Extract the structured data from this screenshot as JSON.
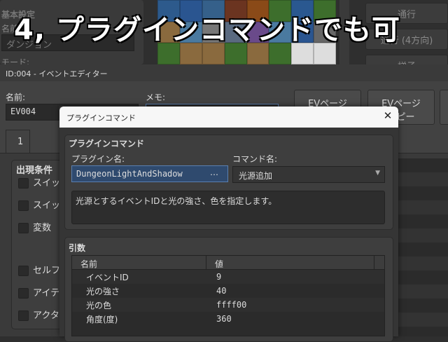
{
  "background": {
    "basic_settings": "基本設定",
    "name_label": "名前:",
    "name_value": "ダンジョン",
    "mode_label": "モード:",
    "buttons": [
      "通行",
      "通行 (4方向)",
      "梯子"
    ]
  },
  "overlay_caption": "4, プラグインコマンドでも可",
  "event_editor": {
    "title": "ID:004 - イベントエディター",
    "name_label": "名前:",
    "name_value": "EV004",
    "memo_label": "メモ:",
    "memo_value": "",
    "page_buttons": [
      "EVページ\n新規作成",
      "EVページ\nコピー"
    ],
    "tab": "1",
    "conditions_label": "出現条件",
    "conditions": [
      "スイッチ",
      "スイッチ",
      "変数",
      "セルフスイッチ",
      "アイテム",
      "アクター"
    ]
  },
  "dialog": {
    "title": "プラグインコマンド",
    "group_title": "プラグインコマンド",
    "plugin_label": "プラグイン名:",
    "plugin_value": "DungeonLightAndShadow",
    "plugin_browse": "…",
    "command_label": "コマンド名:",
    "command_value": "光源追加",
    "description": "光源とするイベントIDと光の強さ、色を指定します。",
    "args_title": "引数",
    "columns": [
      "名前",
      "値"
    ],
    "rows": [
      {
        "name": "イベントID",
        "value": "9"
      },
      {
        "name": "光の強さ",
        "value": "40"
      },
      {
        "name": "光の色",
        "value": "ffff00"
      },
      {
        "name": "角度(度)",
        "value": "360"
      }
    ]
  },
  "colors": {
    "accent": "#4a6d9c",
    "dialog_title_bg": "#f7f7f7"
  }
}
